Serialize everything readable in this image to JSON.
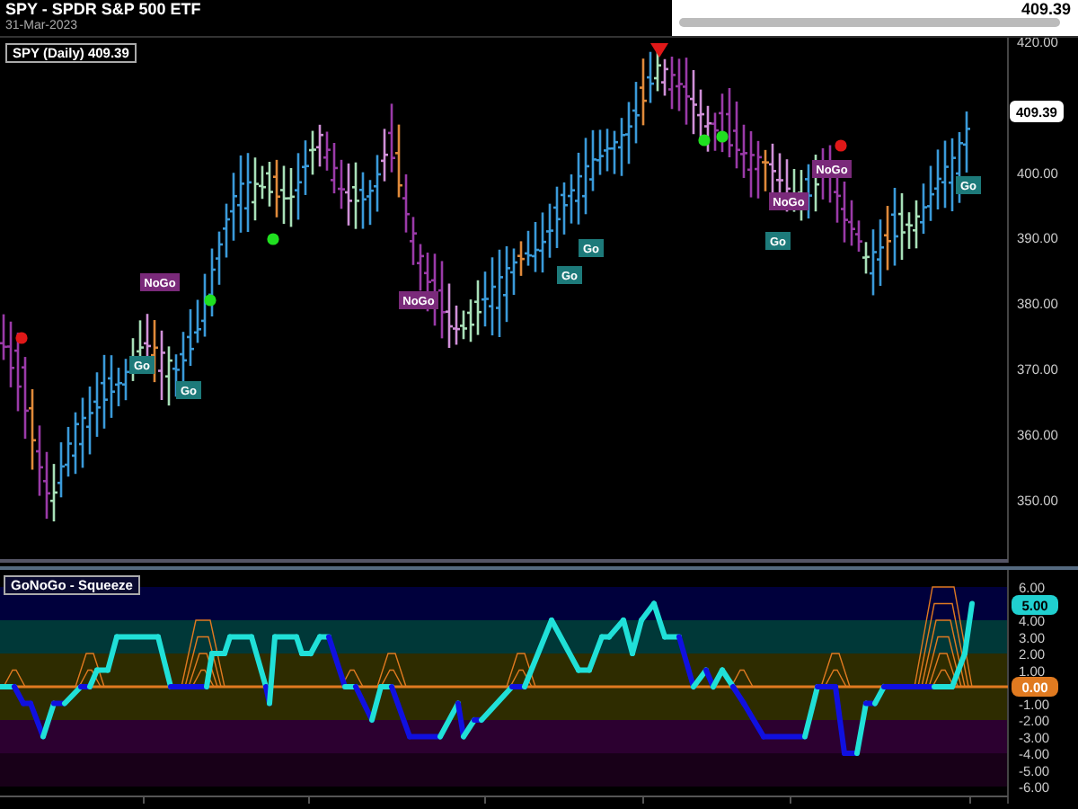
{
  "header": {
    "title": "SPY - SPDR S&P 500 ETF",
    "date": "31-Mar-2023",
    "last_price": "409.39"
  },
  "price_panel": {
    "legend": "SPY (Daily) 409.39",
    "price_tag": "409.39",
    "y_ticks": [
      "420.00",
      "400.00",
      "390.00",
      "380.00",
      "370.00",
      "360.00",
      "350.00"
    ],
    "markers": [
      {
        "kind": "nogo",
        "label": "NoGo"
      },
      {
        "kind": "go",
        "label": "Go"
      },
      {
        "kind": "go",
        "label": "Go"
      },
      {
        "kind": "nogo",
        "label": "NoGo"
      },
      {
        "kind": "go",
        "label": "Go"
      },
      {
        "kind": "go",
        "label": "Go"
      },
      {
        "kind": "nogo",
        "label": "NoGo"
      },
      {
        "kind": "go",
        "label": "Go"
      },
      {
        "kind": "nogo",
        "label": "NoGo"
      },
      {
        "kind": "go",
        "label": "Go"
      }
    ],
    "signals": [
      {
        "color": "#e01818"
      },
      {
        "color": "#20e020"
      },
      {
        "color": "#20e020"
      },
      {
        "color": "#20e020"
      },
      {
        "color": "#20e020"
      },
      {
        "color": "#e01818"
      }
    ]
  },
  "oscillator_panel": {
    "legend": "GoNoGo - Squeeze",
    "value_tag": "5.00",
    "zero_tag": "0.00",
    "y_ticks": [
      "6.00",
      "4.00",
      "3.00",
      "2.00",
      "1.00",
      "-1.00",
      "-2.00",
      "-3.00",
      "-4.00",
      "-5.00",
      "-6.00"
    ]
  }
}
